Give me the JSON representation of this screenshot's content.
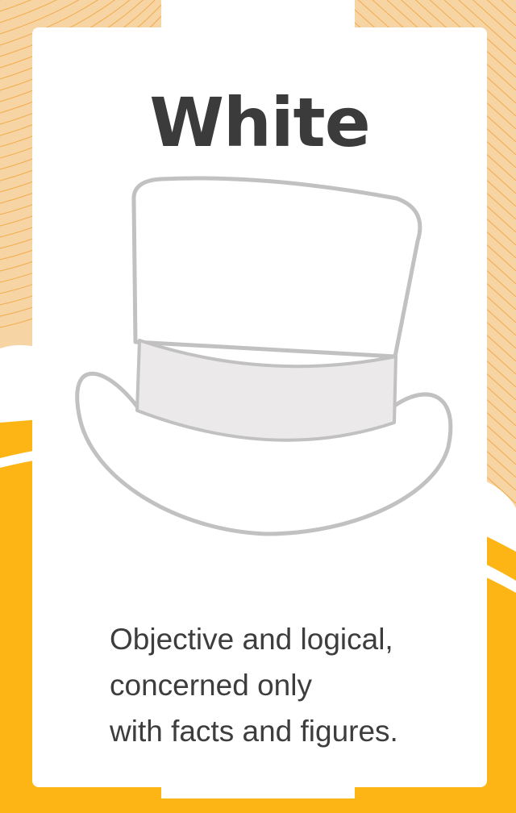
{
  "card": {
    "title": "White",
    "description_lines": [
      "Objective and logical,",
      "concerned only",
      "with facts and figures."
    ]
  },
  "hat": {
    "icon": "top-hat-icon",
    "outline_color": "#c1c1c1",
    "fill_color": "#ffffff",
    "band_color": "#ebe9ea"
  },
  "colors": {
    "background_peach": "#f7d4a3",
    "background_stripes": "#f2a53c",
    "background_orange": "#fcb514",
    "card": "#ffffff",
    "title_text": "#3b3b3b",
    "body_text": "#3d3d3d"
  }
}
